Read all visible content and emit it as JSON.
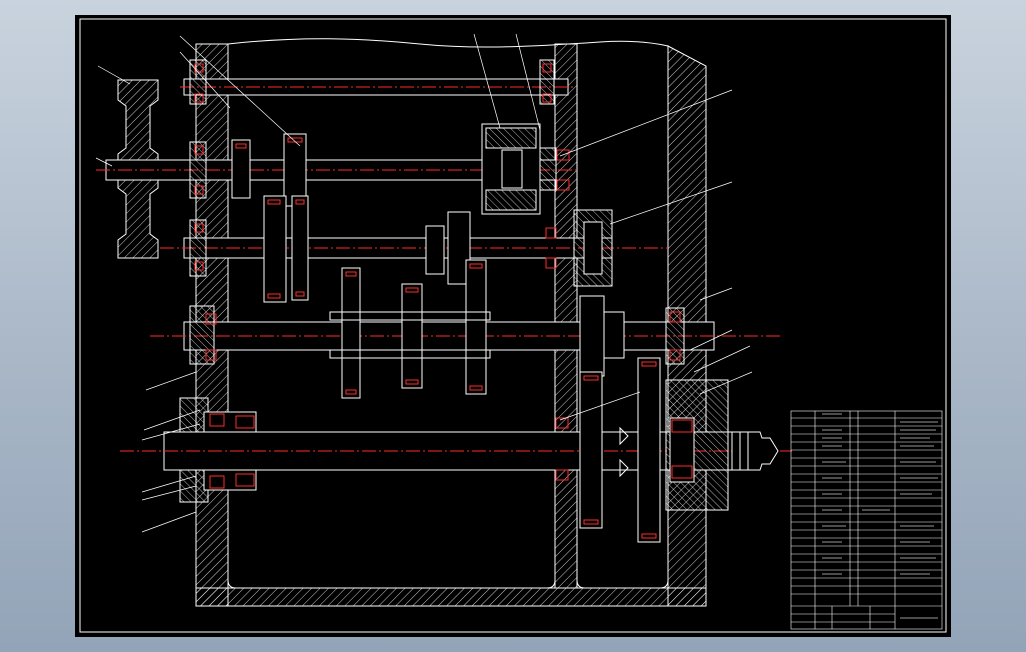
{
  "drawing": {
    "background": "#000000",
    "outline_color": "#ffffff",
    "centerline_color": "#ff2a2a",
    "hatch_color": "#ffffff",
    "bearing_color": "#ff2a2a",
    "text_visible": false
  },
  "title_block": {
    "bom_rows": 20,
    "columns": 4
  }
}
